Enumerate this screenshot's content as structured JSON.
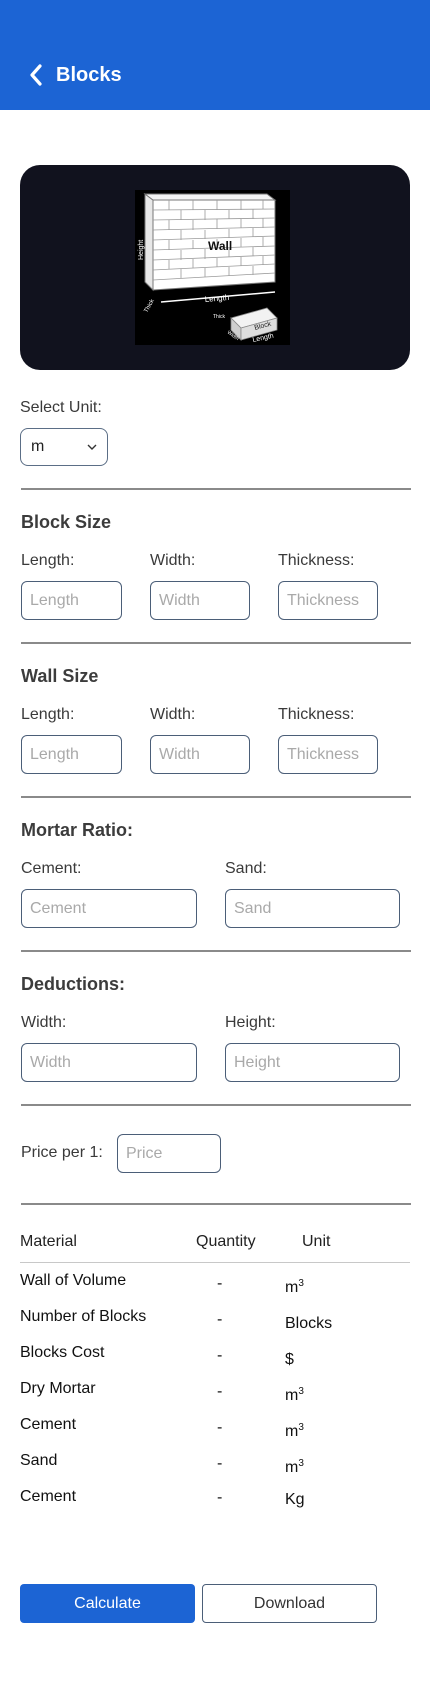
{
  "header": {
    "title": "Blocks",
    "back_icon": "chevron-left-icon",
    "background": "#1c64d4"
  },
  "hero": {
    "image_icon": "wall-block-diagram-icon",
    "wall_text": "Wall",
    "height_text": "Height",
    "length_text": "Length",
    "thick_text": "Thick",
    "block_text": "Block",
    "block_thick_text": "Thick",
    "block_width_text": "Width",
    "block_length_text": "Length"
  },
  "unit": {
    "label": "Select Unit:",
    "selected": "m",
    "icon": "chevron-down-icon"
  },
  "block_size": {
    "title": "Block Size",
    "length_label": "Length:",
    "length_placeholder": "Length",
    "width_label": "Width:",
    "width_placeholder": "Width",
    "thickness_label": "Thickness:",
    "thickness_placeholder": "Thickness"
  },
  "wall_size": {
    "title": "Wall Size",
    "length_label": "Length:",
    "length_placeholder": "Length",
    "width_label": "Width:",
    "width_placeholder": "Width",
    "thickness_label": "Thickness:",
    "thickness_placeholder": "Thickness"
  },
  "mortar": {
    "title": "Mortar Ratio:",
    "cement_label": "Cement:",
    "cement_placeholder": "Cement",
    "sand_label": "Sand:",
    "sand_placeholder": "Sand"
  },
  "deductions": {
    "title": "Deductions:",
    "width_label": "Width:",
    "width_placeholder": "Width",
    "height_label": "Height:",
    "height_placeholder": "Height"
  },
  "price": {
    "label": "Price per 1:",
    "placeholder": "Price"
  },
  "table": {
    "headers": {
      "material": "Material",
      "quantity": "Quantity",
      "unit": "Unit"
    },
    "rows": [
      {
        "material": "Wall of Volume",
        "quantity": "-",
        "unit": "m",
        "sup": "3"
      },
      {
        "material": "Number of Blocks",
        "quantity": "-",
        "unit": "Blocks",
        "sup": ""
      },
      {
        "material": "Blocks Cost",
        "quantity": "-",
        "unit": "$",
        "sup": ""
      },
      {
        "material": "Dry Mortar",
        "quantity": "-",
        "unit": "m",
        "sup": "3"
      },
      {
        "material": "Cement",
        "quantity": "-",
        "unit": "m",
        "sup": "3"
      },
      {
        "material": "Sand",
        "quantity": "-",
        "unit": "m",
        "sup": "3"
      },
      {
        "material": "Cement",
        "quantity": "-",
        "unit": "Kg",
        "sup": ""
      }
    ]
  },
  "actions": {
    "calculate": "Calculate",
    "download": "Download"
  }
}
